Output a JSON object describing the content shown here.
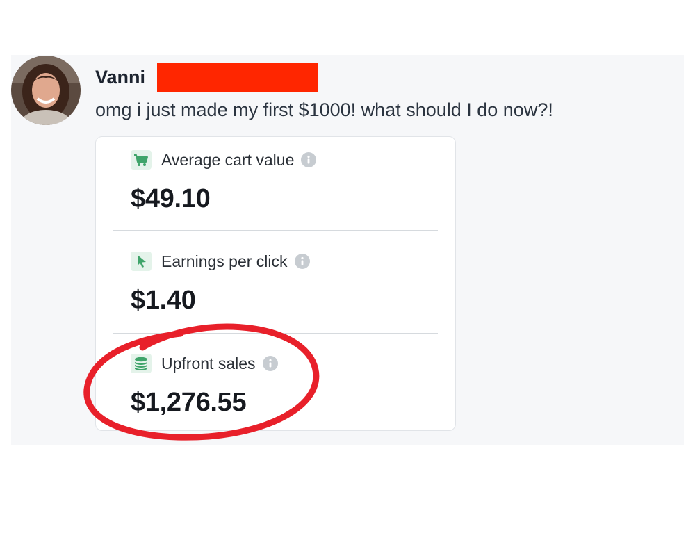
{
  "post": {
    "author": "Vanni",
    "message": "omg i just made my first $1000! what should I do now?!"
  },
  "stats": [
    {
      "label": "Average cart value",
      "value": "$49.10",
      "icon": "shopping-cart-icon"
    },
    {
      "label": "Earnings per click",
      "value": "$1.40",
      "icon": "cursor-arrow-icon"
    },
    {
      "label": "Upfront sales",
      "value": "$1,276.55",
      "icon": "coin-stack-icon"
    }
  ],
  "colors": {
    "accent_green": "#3fa46a",
    "highlight_red": "#e8202a",
    "redaction": "#ff2600"
  }
}
